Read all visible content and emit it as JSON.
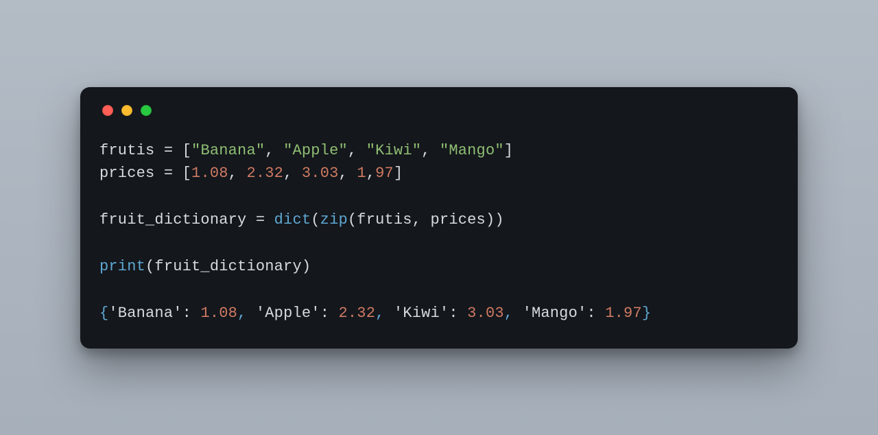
{
  "code": {
    "line1": {
      "var": "frutis",
      "eq": " = ",
      "lb": "[",
      "s1": "\"Banana\"",
      "c1": ", ",
      "s2": "\"Apple\"",
      "c2": ", ",
      "s3": "\"Kiwi\"",
      "c3": ", ",
      "s4": "\"Mango\"",
      "rb": "]"
    },
    "line2": {
      "var": "prices",
      "eq": " = ",
      "lb": "[",
      "n1": "1.08",
      "c1": ", ",
      "n2": "2.32",
      "c2": ", ",
      "n3": "3.03",
      "c3": ", ",
      "n4": "1",
      "c4": ",",
      "n5": "97",
      "rb": "]"
    },
    "line3": {
      "lhs": "fruit_dictionary",
      "eq": " = ",
      "dict": "dict",
      "lp1": "(",
      "zip": "zip",
      "lp2": "(",
      "a1": "frutis",
      "c": ", ",
      "a2": "prices",
      "rp2": ")",
      "rp1": ")"
    },
    "line4": {
      "print": "print",
      "lp": "(",
      "arg": "fruit_dictionary",
      "rp": ")"
    },
    "output": {
      "lb": "{",
      "k1": "'Banana'",
      "colon1": ": ",
      "v1": "1.08",
      "c1": ", ",
      "k2": "'Apple'",
      "colon2": ": ",
      "v2": "2.32",
      "c2": ", ",
      "k3": "'Kiwi'",
      "colon3": ": ",
      "v3": "3.03",
      "c3": ", ",
      "k4": "'Mango'",
      "colon4": ": ",
      "v4": "1.97",
      "rb": "}"
    }
  }
}
